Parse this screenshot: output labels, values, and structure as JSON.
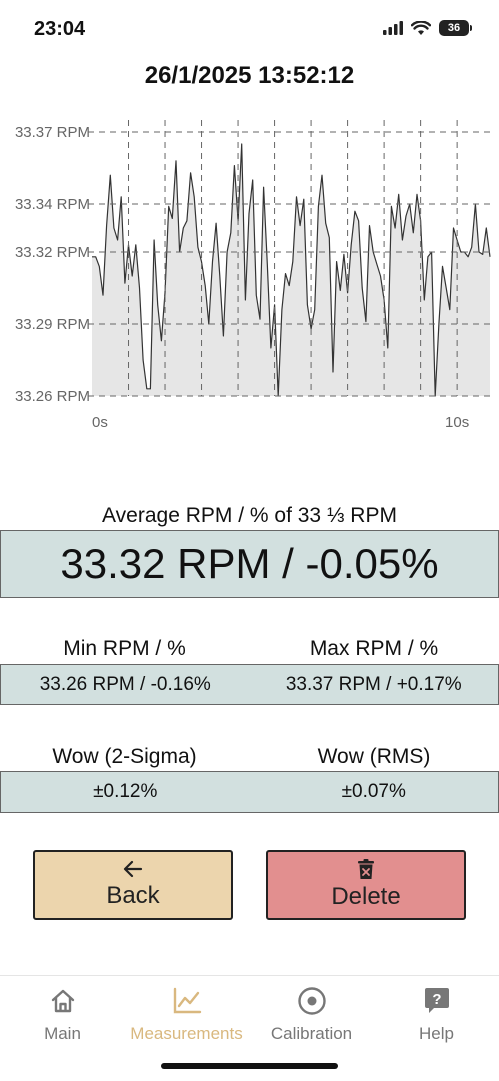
{
  "status": {
    "time": "23:04",
    "battery": "36"
  },
  "title": "26/1/2025 13:52:12",
  "chart_data": {
    "type": "area",
    "y_tick_labels": [
      "33.37 RPM",
      "33.34 RPM",
      "33.32 RPM",
      "33.29 RPM",
      "33.26 RPM"
    ],
    "y_ticks": [
      33.37,
      33.34,
      33.32,
      33.29,
      33.26
    ],
    "x_tick_labels": [
      "0s",
      "10s"
    ],
    "x_range": [
      0,
      10.9
    ],
    "ylim": [
      33.26,
      33.375
    ],
    "grid": true,
    "line_color": "#333333",
    "fill_color": "#e6e6e6",
    "x": [
      0.0,
      0.1,
      0.2,
      0.3,
      0.4,
      0.5,
      0.6,
      0.7,
      0.8,
      0.9,
      1.0,
      1.1,
      1.2,
      1.3,
      1.4,
      1.5,
      1.6,
      1.7,
      1.8,
      1.9,
      2.0,
      2.1,
      2.2,
      2.3,
      2.4,
      2.5,
      2.6,
      2.7,
      2.8,
      2.9,
      3.0,
      3.1,
      3.2,
      3.3,
      3.4,
      3.5,
      3.6,
      3.7,
      3.8,
      3.9,
      4.0,
      4.1,
      4.2,
      4.3,
      4.4,
      4.5,
      4.6,
      4.7,
      4.8,
      4.9,
      5.0,
      5.1,
      5.2,
      5.3,
      5.4,
      5.5,
      5.6,
      5.7,
      5.8,
      5.9,
      6.0,
      6.1,
      6.2,
      6.3,
      6.4,
      6.5,
      6.6,
      6.7,
      6.8,
      6.9,
      7.0,
      7.1,
      7.2,
      7.3,
      7.4,
      7.5,
      7.6,
      7.7,
      7.8,
      7.9,
      8.0,
      8.1,
      8.2,
      8.3,
      8.4,
      8.5,
      8.6,
      8.7,
      8.8,
      8.9,
      9.0,
      9.1,
      9.2,
      9.3,
      9.4,
      9.5,
      9.6,
      9.7,
      9.8,
      9.9,
      10.0,
      10.1,
      10.2,
      10.3,
      10.4,
      10.5,
      10.6,
      10.7,
      10.8,
      10.9
    ],
    "y": [
      33.318,
      33.318,
      33.314,
      33.302,
      33.331,
      33.352,
      33.33,
      33.325,
      33.343,
      33.307,
      33.323,
      33.31,
      33.323,
      33.305,
      33.275,
      33.263,
      33.263,
      33.325,
      33.298,
      33.283,
      33.303,
      33.339,
      33.334,
      33.358,
      33.32,
      33.33,
      33.333,
      33.353,
      33.343,
      33.322,
      33.316,
      33.306,
      33.29,
      33.316,
      33.332,
      33.31,
      33.285,
      33.32,
      33.328,
      33.356,
      33.333,
      33.365,
      33.3,
      33.336,
      33.35,
      33.302,
      33.292,
      33.347,
      33.315,
      33.28,
      33.298,
      33.26,
      33.296,
      33.311,
      33.306,
      33.316,
      33.343,
      33.331,
      33.342,
      33.298,
      33.288,
      33.296,
      33.339,
      33.352,
      33.332,
      33.326,
      33.27,
      33.316,
      33.304,
      33.319,
      33.303,
      33.323,
      33.337,
      33.333,
      33.305,
      33.291,
      33.331,
      33.32,
      33.315,
      33.31,
      33.3,
      33.28,
      33.339,
      33.33,
      33.344,
      33.325,
      33.335,
      33.34,
      33.328,
      33.344,
      33.333,
      33.3,
      33.318,
      33.32,
      33.26,
      33.29,
      33.314,
      33.305,
      33.296,
      33.33,
      33.325,
      33.32,
      33.32,
      33.318,
      33.322,
      33.34,
      33.32,
      33.319,
      33.33,
      33.318
    ]
  },
  "average": {
    "label": "Average RPM / % of 33 ⅓ RPM",
    "value": "33.32 RPM / -0.05%"
  },
  "minmax": {
    "min_label": "Min RPM / %",
    "max_label": "Max RPM / %",
    "min_value": "33.26 RPM / -0.16%",
    "max_value": "33.37 RPM / +0.17%"
  },
  "wow": {
    "sigma_label": "Wow (2-Sigma)",
    "rms_label": "Wow (RMS)",
    "sigma_value": "±0.12%",
    "rms_value": "±0.07%"
  },
  "buttons": {
    "back_label": "Back",
    "back_icon": "arrow-left-icon",
    "back_color": "#ecd5ad",
    "delete_label": "Delete",
    "delete_icon": "trash-icon",
    "delete_color": "#e28f8f"
  },
  "tabs": [
    {
      "label": "Main",
      "icon": "home-icon"
    },
    {
      "label": "Measurements",
      "icon": "chart-icon",
      "active": true
    },
    {
      "label": "Calibration",
      "icon": "target-icon"
    },
    {
      "label": "Help",
      "icon": "help-icon"
    }
  ],
  "accent_color": "#d9b87f"
}
